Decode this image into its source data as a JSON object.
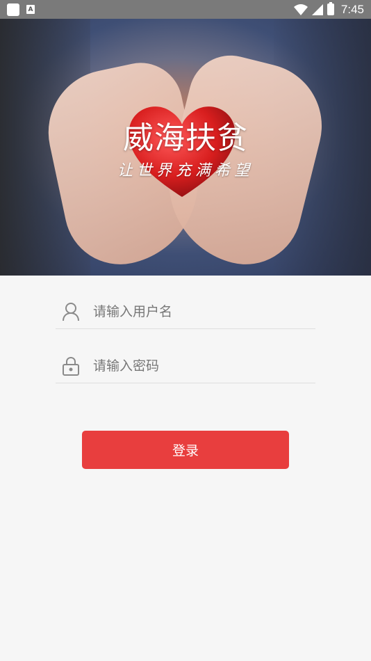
{
  "status_bar": {
    "time": "7:45",
    "icons": [
      "app-square-icon",
      "a-notification-icon",
      "wifi-icon",
      "signal-icon",
      "battery-charging-icon"
    ]
  },
  "banner": {
    "title": "威海扶贫",
    "slogan": "让世界充满希望",
    "image": "hands-holding-red-heart"
  },
  "login_form": {
    "username": {
      "placeholder": "请输入用户名",
      "value": "",
      "icon": "user-icon"
    },
    "password": {
      "placeholder": "请输入密码",
      "value": "",
      "icon": "lock-icon"
    },
    "submit_label": "登录"
  },
  "colors": {
    "accent": "#e83e3e",
    "background": "#f6f6f6",
    "status_bar": "#7a7a7a"
  }
}
